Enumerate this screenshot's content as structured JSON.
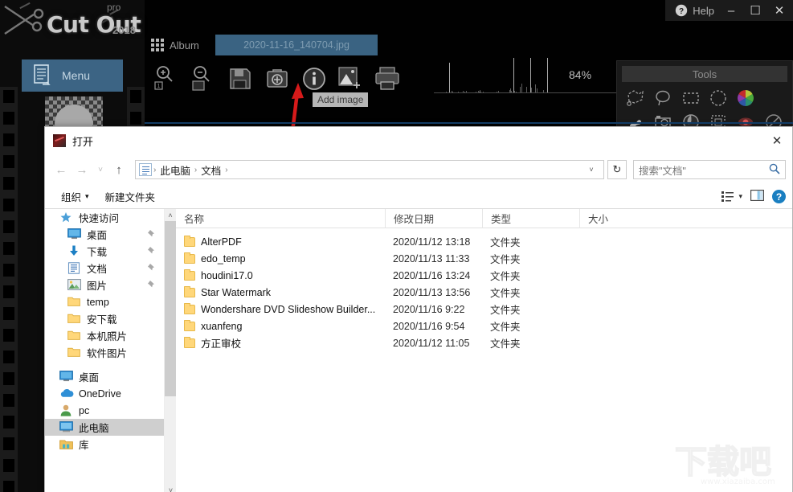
{
  "app": {
    "logo": {
      "name": "Cut Out",
      "pro": "pro",
      "year": "2018"
    },
    "titlebar": {
      "help_label": "Help",
      "minimize_icon": "–",
      "maximize_icon": "☐",
      "close_icon": "✕"
    },
    "album_tab": {
      "label": "Album",
      "icon": "grid-icon"
    },
    "open_file_tab": "2020-11-16_140704.jpg",
    "menu_button": {
      "label": "Menu"
    },
    "toolbar": {
      "items": [
        {
          "name": "zoom-in-icon",
          "title": "Zoom In"
        },
        {
          "name": "zoom-out-icon",
          "title": "Zoom Out"
        },
        {
          "name": "save-icon",
          "title": "Save"
        },
        {
          "name": "toolbox-icon",
          "title": "Toolbox"
        },
        {
          "name": "info-icon",
          "title": "Info"
        },
        {
          "name": "add-image-icon",
          "title": "Add image"
        },
        {
          "name": "print-icon",
          "title": "Print"
        }
      ]
    },
    "tooltip": "Add image",
    "zoom_level": "84%",
    "tools_panel": {
      "title": "Tools",
      "row1": [
        "polygon-lasso-icon",
        "freehand-lasso-icon",
        "rectangle-select-icon",
        "ellipse-select-icon",
        "color-wheel-icon"
      ],
      "row2": [
        "smudge-icon",
        "camera-icon",
        "paint-bucket-icon",
        "marching-ants-icon",
        "red-eye-icon",
        "no-tool-icon"
      ]
    }
  },
  "dialog": {
    "title": "打开",
    "close_icon": "✕",
    "nav": {
      "back_icon": "←",
      "forward_icon": "→",
      "recent_icon": "˅",
      "up_icon": "↑",
      "breadcrumbs": [
        "此电脑",
        "文档"
      ],
      "separator": "›",
      "dropdown_icon": "˅",
      "refresh_icon": "↻"
    },
    "search": {
      "placeholder": "搜索\"文档\"",
      "icon": "search-icon"
    },
    "commandbar": {
      "organize": "组织",
      "organize_caret": "▾",
      "new_folder": "新建文件夹",
      "view_icon": "list-view-icon",
      "view_caret": "▾",
      "preview_icon": "preview-pane-icon",
      "help_icon": "?"
    },
    "sidebar": {
      "items": [
        {
          "label": "快速访问",
          "icon": "star-icon",
          "pinned": false,
          "level": 0,
          "selected": false
        },
        {
          "label": "桌面",
          "icon": "desktop-icon",
          "pinned": true,
          "level": 1,
          "selected": false
        },
        {
          "label": "下载",
          "icon": "download-icon",
          "pinned": true,
          "level": 1,
          "selected": false
        },
        {
          "label": "文档",
          "icon": "documents-icon",
          "pinned": true,
          "level": 1,
          "selected": false
        },
        {
          "label": "图片",
          "icon": "pictures-icon",
          "pinned": true,
          "level": 1,
          "selected": false
        },
        {
          "label": "temp",
          "icon": "folder-icon",
          "pinned": false,
          "level": 1,
          "selected": false
        },
        {
          "label": "安下载",
          "icon": "folder-icon",
          "pinned": false,
          "level": 1,
          "selected": false
        },
        {
          "label": "本机照片",
          "icon": "folder-icon",
          "pinned": false,
          "level": 1,
          "selected": false
        },
        {
          "label": "软件图片",
          "icon": "folder-icon",
          "pinned": false,
          "level": 1,
          "selected": false
        },
        {
          "label": "桌面",
          "icon": "desktop-icon",
          "pinned": false,
          "level": 0,
          "selected": false
        },
        {
          "label": "OneDrive",
          "icon": "onedrive-icon",
          "pinned": false,
          "level": 0,
          "selected": false
        },
        {
          "label": "pc",
          "icon": "user-icon",
          "pinned": false,
          "level": 0,
          "selected": false
        },
        {
          "label": "此电脑",
          "icon": "this-pc-icon",
          "pinned": false,
          "level": 0,
          "selected": true
        },
        {
          "label": "库",
          "icon": "library-icon",
          "pinned": false,
          "level": 0,
          "selected": false
        }
      ],
      "scroll_up_icon": "˄",
      "scroll_down_icon": "˅"
    },
    "files": {
      "columns": [
        "名称",
        "修改日期",
        "类型",
        "大小"
      ],
      "rows": [
        {
          "name": "AlterPDF",
          "date": "2020/11/12 13:18",
          "type": "文件夹",
          "size": ""
        },
        {
          "name": "edo_temp",
          "date": "2020/11/13 11:33",
          "type": "文件夹",
          "size": ""
        },
        {
          "name": "houdini17.0",
          "date": "2020/11/16 13:24",
          "type": "文件夹",
          "size": ""
        },
        {
          "name": "Star Watermark",
          "date": "2020/11/13 13:56",
          "type": "文件夹",
          "size": ""
        },
        {
          "name": "Wondershare DVD Slideshow Builder...",
          "date": "2020/11/16 9:22",
          "type": "文件夹",
          "size": ""
        },
        {
          "name": "xuanfeng",
          "date": "2020/11/16 9:54",
          "type": "文件夹",
          "size": ""
        },
        {
          "name": "方正审校",
          "date": "2020/11/12 11:05",
          "type": "文件夹",
          "size": ""
        }
      ]
    }
  },
  "watermark": {
    "text": "下载吧",
    "url": "www.xiazaiba.com"
  },
  "colors": {
    "accent_blue": "#3c6484",
    "dialog_bg": "#ffffff",
    "selection_gray": "#cfcfcf",
    "folder_yellow": "#ffd77a",
    "arrow_red": "#d61a1a"
  }
}
